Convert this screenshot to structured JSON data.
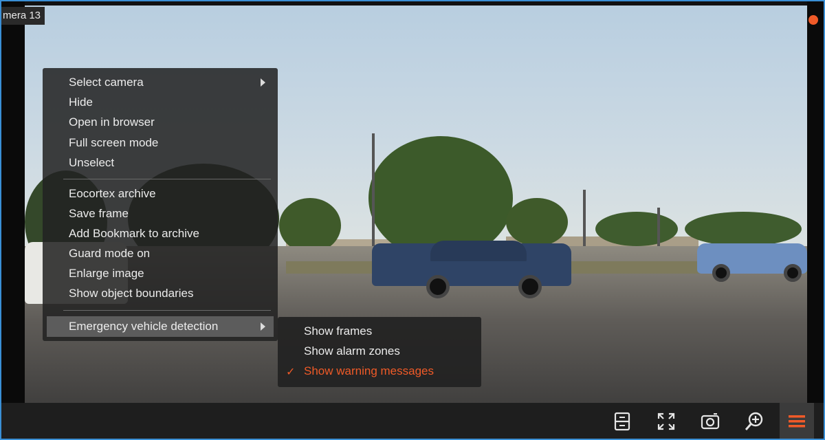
{
  "camera": {
    "label": "mera 13"
  },
  "context_menu": {
    "group1": [
      "Select camera",
      "Hide",
      "Open in browser",
      "Full screen mode",
      "Unselect"
    ],
    "group2": [
      "Eocortex archive",
      "Save frame",
      "Add Bookmark to archive",
      "Guard mode on",
      "Enlarge image",
      "Show object boundaries"
    ],
    "group3": [
      "Emergency vehicle detection"
    ]
  },
  "submenu": {
    "items": [
      "Show frames",
      "Show alarm zones",
      "Show warning messages"
    ],
    "checked_item": "Show warning messages",
    "check_glyph": "✓"
  },
  "toolbar": {
    "icons": [
      "layout-icon",
      "fullscreen-icon",
      "snapshot-icon",
      "zoom-in-icon",
      "hamburger-menu-icon"
    ]
  },
  "colors": {
    "accent": "#f05a28",
    "border": "#3a8fd6",
    "menu_bg": "#222222"
  }
}
